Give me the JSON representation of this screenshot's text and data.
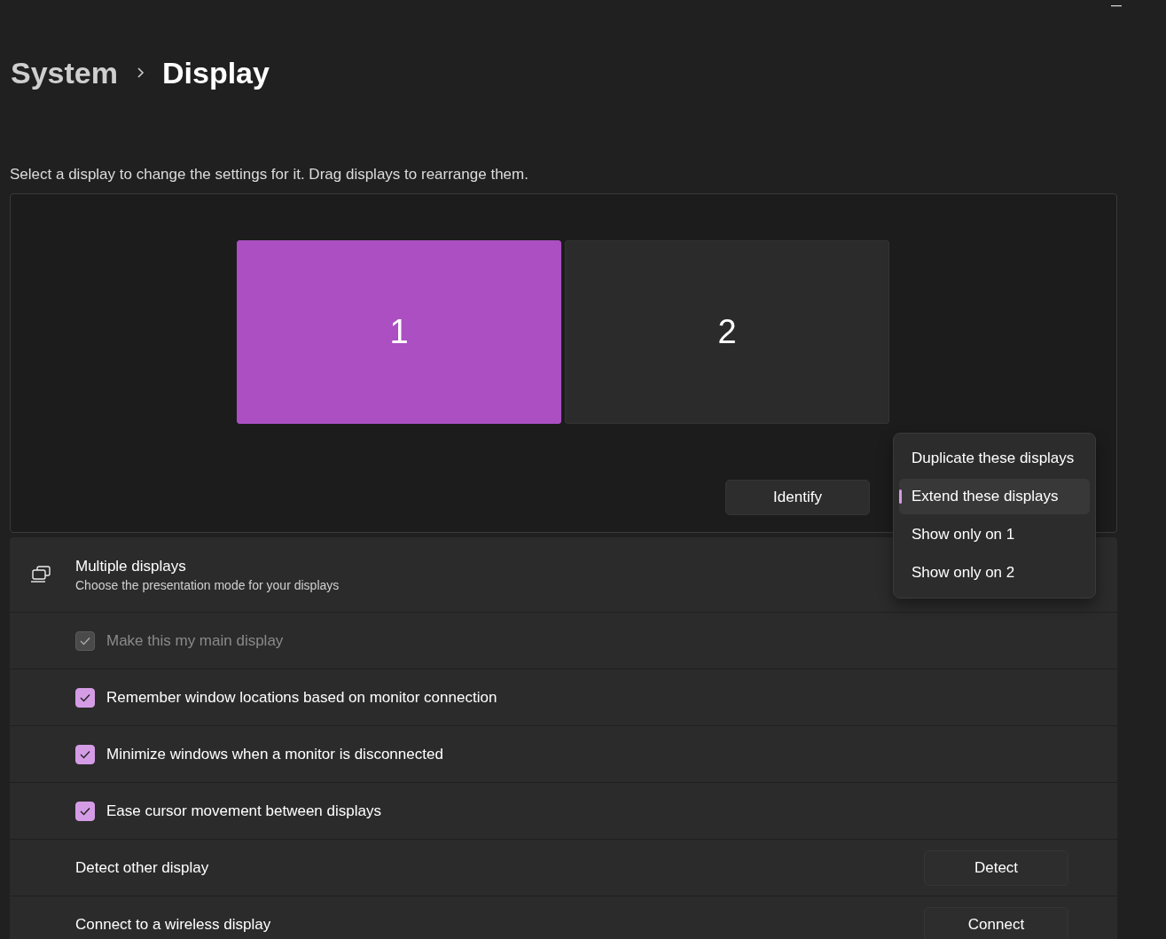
{
  "breadcrumb": {
    "parent": "System",
    "current": "Display"
  },
  "instruction": "Select a display to change the settings for it. Drag displays to rearrange them.",
  "monitors": [
    {
      "label": "1",
      "selected": true
    },
    {
      "label": "2",
      "selected": false
    }
  ],
  "identify_button": "Identify",
  "presentation_menu": [
    {
      "label": "Duplicate these displays",
      "selected": false
    },
    {
      "label": "Extend these displays",
      "selected": true
    },
    {
      "label": "Show only on 1",
      "selected": false
    },
    {
      "label": "Show only on 2",
      "selected": false
    }
  ],
  "multiple_displays": {
    "title": "Multiple displays",
    "subtitle": "Choose the presentation mode for your displays"
  },
  "rows": [
    {
      "kind": "checkbox",
      "label": "Make this my main display",
      "checked": true,
      "disabled": true
    },
    {
      "kind": "checkbox",
      "label": "Remember window locations based on monitor connection",
      "checked": true,
      "disabled": false
    },
    {
      "kind": "checkbox",
      "label": "Minimize windows when a monitor is disconnected",
      "checked": true,
      "disabled": false
    },
    {
      "kind": "checkbox",
      "label": "Ease cursor movement between displays",
      "checked": true,
      "disabled": false
    },
    {
      "kind": "button",
      "label": "Detect other display",
      "button": "Detect"
    },
    {
      "kind": "button",
      "label": "Connect to a wireless display",
      "button": "Connect"
    }
  ]
}
